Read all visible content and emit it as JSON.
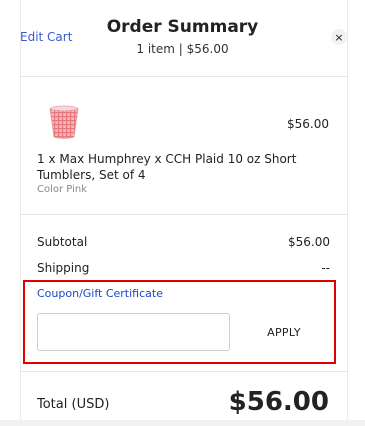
{
  "header": {
    "edit_cart": "Edit Cart",
    "title": "Order Summary",
    "subtitle": "1 item | $56.00",
    "close_icon": "close-icon",
    "close_glyph": "×"
  },
  "item": {
    "price": "$56.00",
    "name": "1 x Max Humphrey x CCH Plaid 10 oz Short Tumblers, Set of 4",
    "variant": "Color Pink",
    "thumbnail_icon": "pink-plaid-tumbler-image",
    "thumbnail_color": "#f2a5a8"
  },
  "summary": {
    "subtotal_label": "Subtotal",
    "subtotal_value": "$56.00",
    "shipping_label": "Shipping",
    "shipping_value": "--"
  },
  "coupon": {
    "label": "Coupon/Gift Certificate",
    "input_value": "",
    "apply_label": "APPLY",
    "highlight_color": "#e00000"
  },
  "total": {
    "label": "Total (USD)",
    "value": "$56.00"
  },
  "colors": {
    "link": "#3b5bcc",
    "coupon_link": "#1d46c8"
  }
}
